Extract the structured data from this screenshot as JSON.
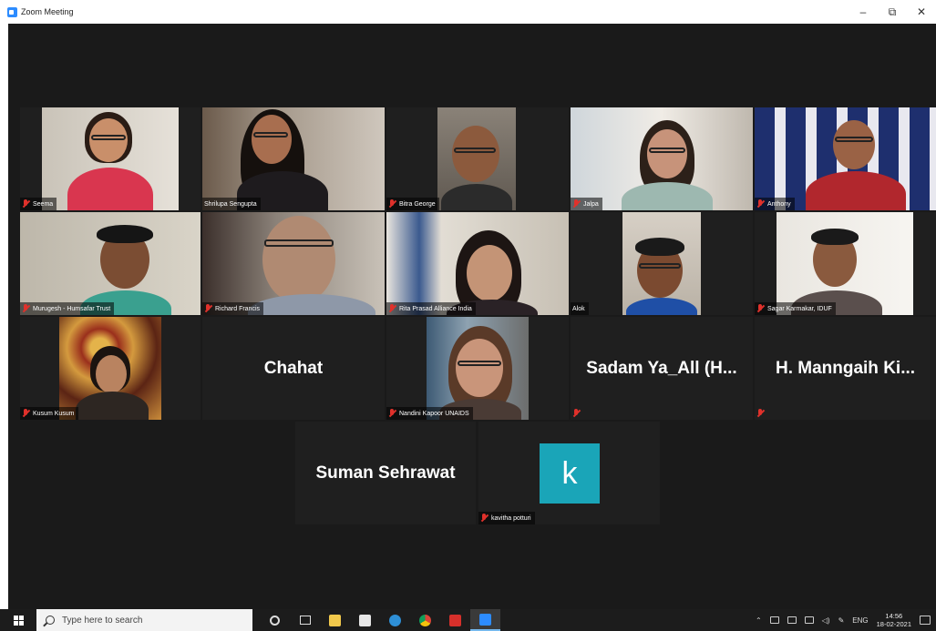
{
  "window": {
    "title": "Zoom Meeting",
    "minimize": "–",
    "maximize": "⧉",
    "close": "✕"
  },
  "participants": [
    {
      "name": "Seema",
      "video": true,
      "muted": true
    },
    {
      "name": "Shrilupa Sengupta",
      "video": true,
      "muted": false,
      "active_speaker": true
    },
    {
      "name": "Bitra George",
      "video": true,
      "muted": true
    },
    {
      "name": "Jalpa",
      "video": true,
      "muted": true
    },
    {
      "name": "Anthony",
      "video": true,
      "muted": true
    },
    {
      "name": "Murugesh - Humsafar Trust",
      "video": true,
      "muted": true
    },
    {
      "name": "Richard Francis",
      "video": true,
      "muted": true
    },
    {
      "name": "Rita Prasad Alliance India",
      "video": true,
      "muted": true
    },
    {
      "name": "Alok",
      "video": true,
      "muted": false
    },
    {
      "name": "Sagar Karmakar, IDUF",
      "video": true,
      "muted": true
    },
    {
      "name": "Kusum Kusum",
      "video": true,
      "muted": true
    },
    {
      "name": "Chahat",
      "video": false,
      "muted": false
    },
    {
      "name": "Nandini Kapoor UNAIDS",
      "video": true,
      "muted": true
    },
    {
      "name": "Sadam Ya_All (H...",
      "video": false,
      "muted": true
    },
    {
      "name": "H. Manngaih Ki...",
      "video": false,
      "muted": true
    },
    {
      "name": "Suman Sehrawat",
      "video": false,
      "muted": false
    },
    {
      "name": "kavitha potturi",
      "video": false,
      "muted": true,
      "avatar_letter": "k"
    }
  ],
  "taskbar": {
    "search_placeholder": "Type here to search",
    "language": "ENG",
    "time": "14:56",
    "date": "18-02-2021"
  },
  "colors": {
    "meeting_bg": "#1a1a1a",
    "active_speaker_border": "#d9e04e",
    "muted_icon": "#e0312b",
    "avatar_bg": "#1aa5b8"
  }
}
